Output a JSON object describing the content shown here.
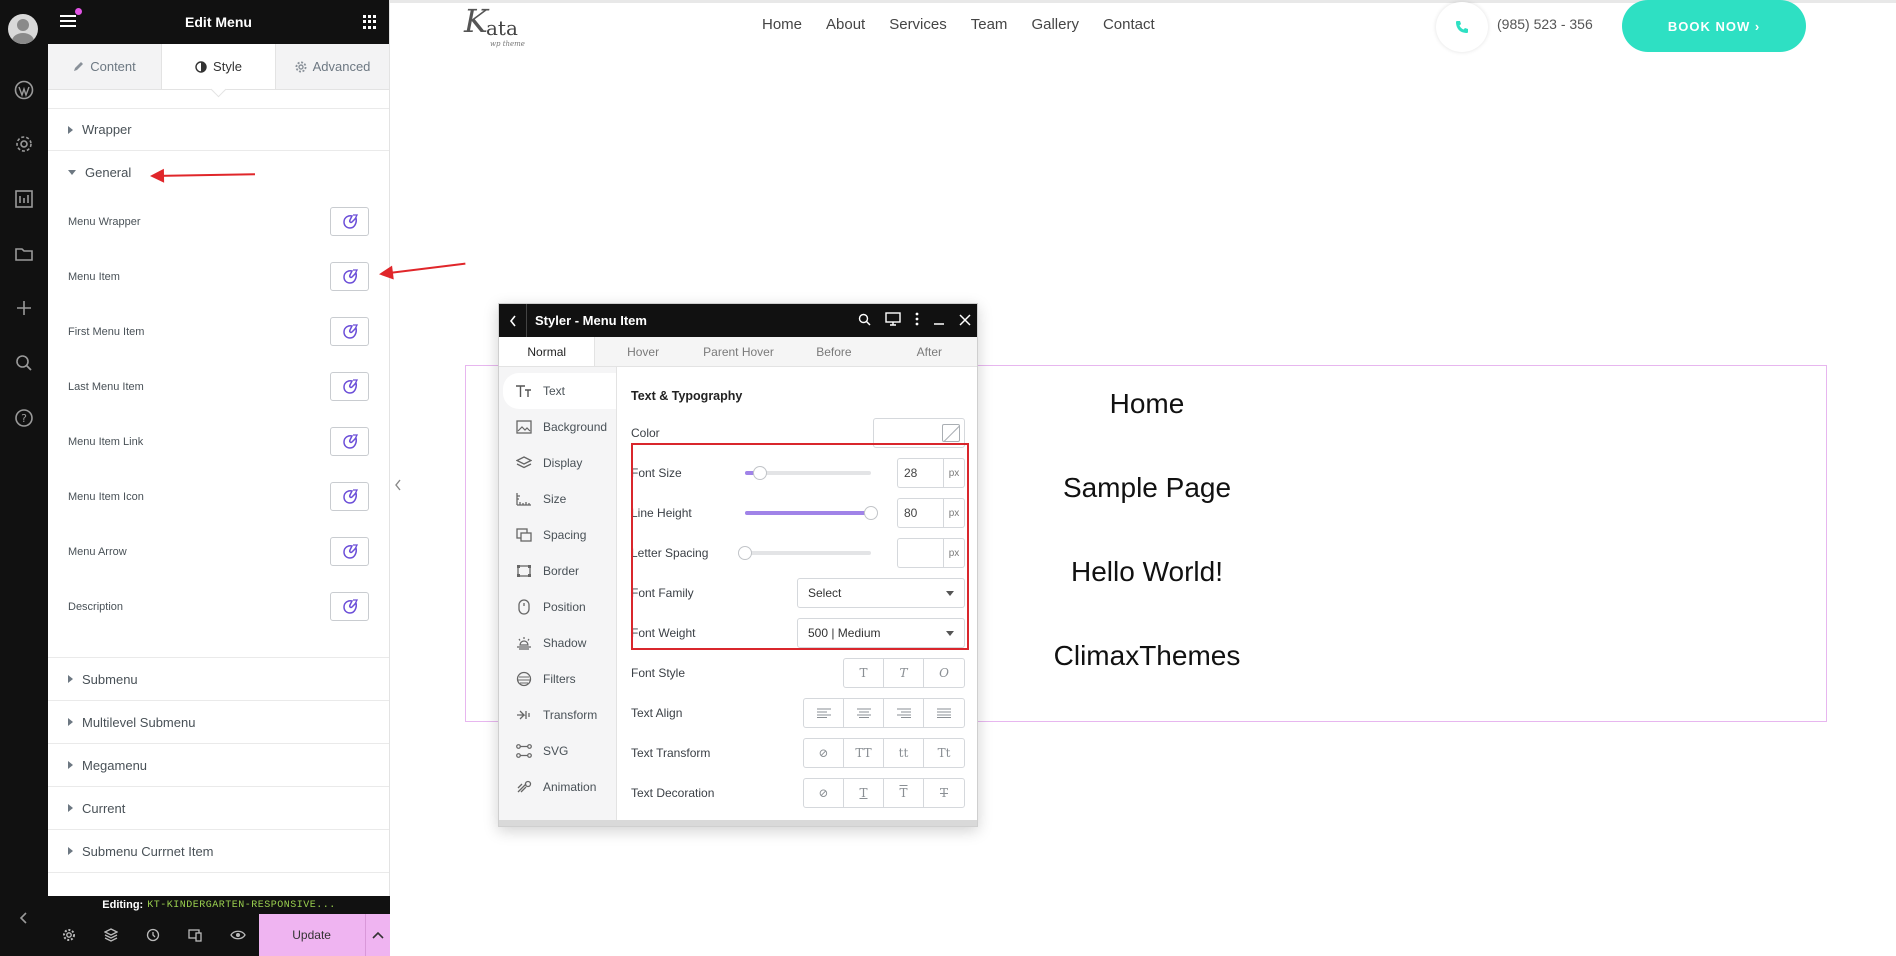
{
  "panel": {
    "title": "Edit Menu",
    "tabs": [
      {
        "label": "Content"
      },
      {
        "label": "Style"
      },
      {
        "label": "Advanced"
      }
    ],
    "sections_top": [
      {
        "label": "Wrapper"
      },
      {
        "label": "General"
      }
    ],
    "general_controls": [
      {
        "label": "Menu Wrapper"
      },
      {
        "label": "Menu Item"
      },
      {
        "label": "First Menu Item"
      },
      {
        "label": "Last Menu Item"
      },
      {
        "label": "Menu Item Link"
      },
      {
        "label": "Menu Item Icon"
      },
      {
        "label": "Menu Arrow"
      },
      {
        "label": "Description"
      }
    ],
    "sections_bottom": [
      {
        "label": "Submenu"
      },
      {
        "label": "Multilevel Submenu"
      },
      {
        "label": "Megamenu"
      },
      {
        "label": "Current"
      },
      {
        "label": "Submenu Currnet Item"
      }
    ],
    "editing_label": "Editing:",
    "editing_doc": "KT-KINDERGARTEN-RESPONSIVE...",
    "update_label": "Update"
  },
  "site": {
    "logo": {
      "word": "ata",
      "tagline": "wp theme"
    },
    "nav": [
      "Home",
      "About",
      "Services",
      "Team",
      "Gallery",
      "Contact"
    ],
    "phone": "(985) 523 - 356",
    "book_label": "BOOK NOW ›",
    "accent": "#2ee0c3"
  },
  "widget": {
    "items": [
      "Home",
      "Sample Page",
      "Hello World!",
      "ClimaxThemes"
    ]
  },
  "styler": {
    "title": "Styler - Menu Item",
    "tabs": [
      "Normal",
      "Hover",
      "Parent Hover",
      "Before",
      "After"
    ],
    "sidebar": [
      {
        "label": "Text",
        "icon": "text-icon"
      },
      {
        "label": "Background",
        "icon": "image-icon"
      },
      {
        "label": "Display",
        "icon": "layers-icon"
      },
      {
        "label": "Size",
        "icon": "ruler-icon"
      },
      {
        "label": "Spacing",
        "icon": "spacing-icon"
      },
      {
        "label": "Border",
        "icon": "border-icon"
      },
      {
        "label": "Position",
        "icon": "mouse-icon"
      },
      {
        "label": "Shadow",
        "icon": "shadow-icon"
      },
      {
        "label": "Filters",
        "icon": "filter-icon"
      },
      {
        "label": "Transform",
        "icon": "transform-icon"
      },
      {
        "label": "SVG",
        "icon": "svg-icon"
      },
      {
        "label": "Animation",
        "icon": "animation-icon"
      }
    ],
    "section_title": "Text & Typography",
    "color_label": "Color",
    "font_size": {
      "label": "Font Size",
      "value": "28",
      "unit": "px",
      "fill": 0.12
    },
    "line_height": {
      "label": "Line Height",
      "value": "80",
      "unit": "px",
      "fill": 1.0
    },
    "letter_spacing": {
      "label": "Letter Spacing",
      "value": "",
      "unit": "px",
      "fill": 0.0
    },
    "font_family": {
      "label": "Font Family",
      "value": "Select"
    },
    "font_weight": {
      "label": "Font Weight",
      "value": "500 | Medium"
    },
    "font_style": {
      "label": "Font Style",
      "options": [
        "T",
        "T",
        "O"
      ]
    },
    "text_align": {
      "label": "Text Align"
    },
    "text_transform": {
      "label": "Text Transform",
      "options": [
        "⊘",
        "TT",
        "tt",
        "Tt"
      ]
    },
    "text_decoration": {
      "label": "Text Decoration",
      "options": [
        "⊘",
        "T",
        "T",
        "T"
      ]
    }
  }
}
